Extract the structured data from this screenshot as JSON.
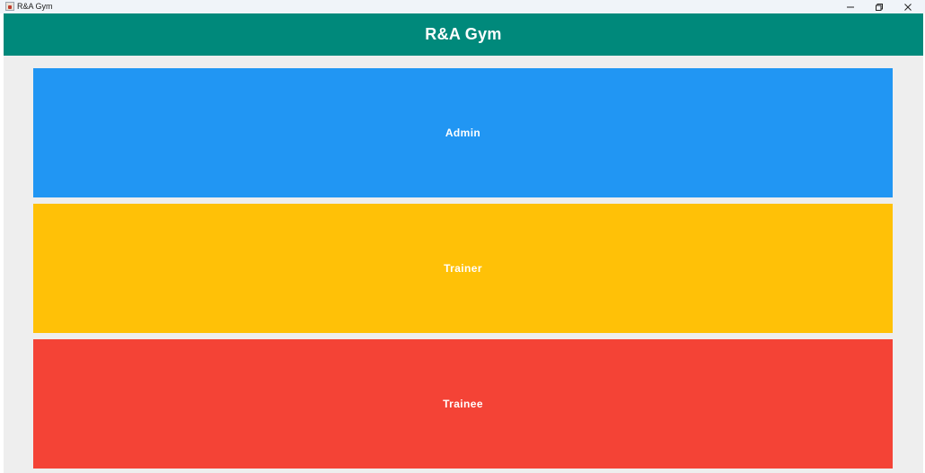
{
  "window": {
    "title": "R&A Gym",
    "controls": {
      "minimize_icon": "minimize-icon",
      "maximize_icon": "restore-icon",
      "close_icon": "close-icon"
    }
  },
  "header": {
    "title": "R&A Gym",
    "color": "#00897b"
  },
  "roles": [
    {
      "label": "Admin",
      "color": "#2196f3"
    },
    {
      "label": "Trainer",
      "color": "#ffc107"
    },
    {
      "label": "Trainee",
      "color": "#f44336"
    }
  ],
  "background_color": "#eeeeee"
}
